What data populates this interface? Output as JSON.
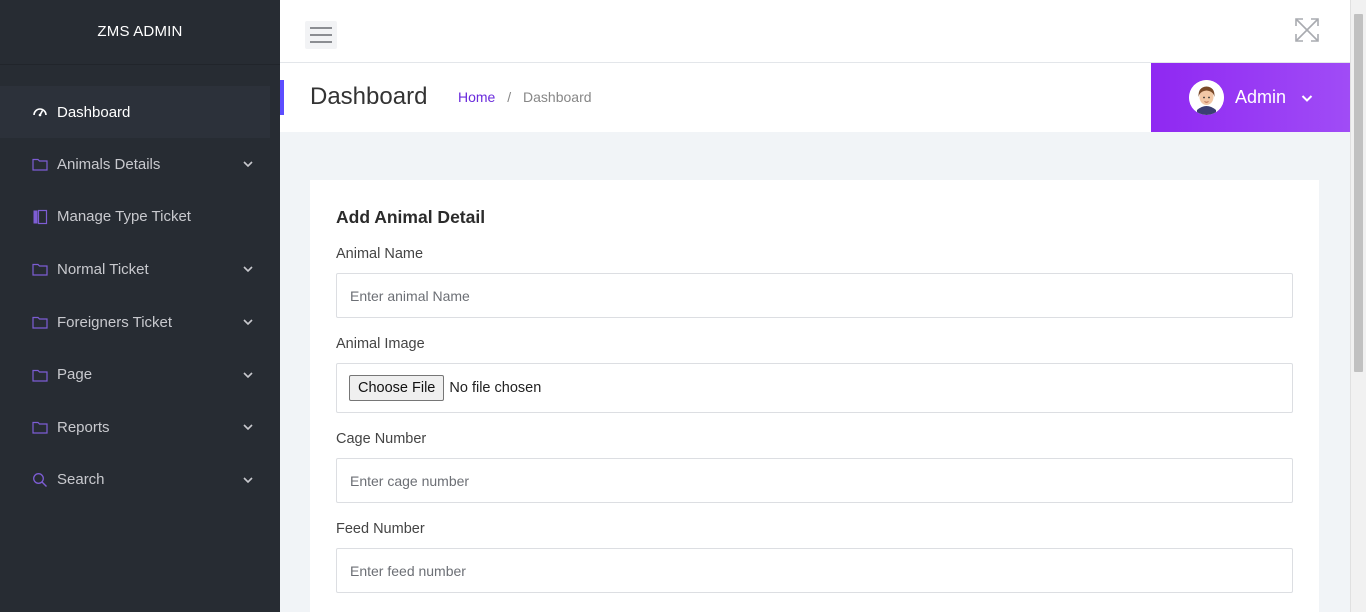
{
  "brand": "ZMS ADMIN",
  "sidebar": {
    "items": [
      {
        "label": "Dashboard",
        "icon": "dashboard-gauge-icon"
      },
      {
        "label": "Animals Details",
        "icon": "folder-icon"
      },
      {
        "label": "Manage Type Ticket",
        "icon": "book-icon"
      },
      {
        "label": "Normal Ticket",
        "icon": "folder-icon"
      },
      {
        "label": "Foreigners Ticket",
        "icon": "folder-icon"
      },
      {
        "label": "Page",
        "icon": "folder-icon"
      },
      {
        "label": "Reports",
        "icon": "folder-icon"
      },
      {
        "label": "Search",
        "icon": "search-icon"
      }
    ]
  },
  "header": {
    "page_title": "Dashboard",
    "breadcrumb": {
      "home": "Home",
      "separator": "/",
      "current": "Dashboard"
    },
    "user": {
      "name": "Admin"
    }
  },
  "form": {
    "title": "Add Animal Detail",
    "animal_name": {
      "label": "Animal Name",
      "placeholder": "Enter animal Name"
    },
    "animal_image": {
      "label": "Animal Image",
      "button": "Choose File",
      "status": "No file chosen"
    },
    "cage_number": {
      "label": "Cage Number",
      "placeholder": "Enter cage number"
    },
    "feed_number": {
      "label": "Feed Number",
      "placeholder": "Enter feed number"
    }
  },
  "colors": {
    "sidebar_bg": "#272c33",
    "accent": "#5c4dff",
    "user_box": "#8f28f2",
    "link": "#6a2bdc"
  }
}
